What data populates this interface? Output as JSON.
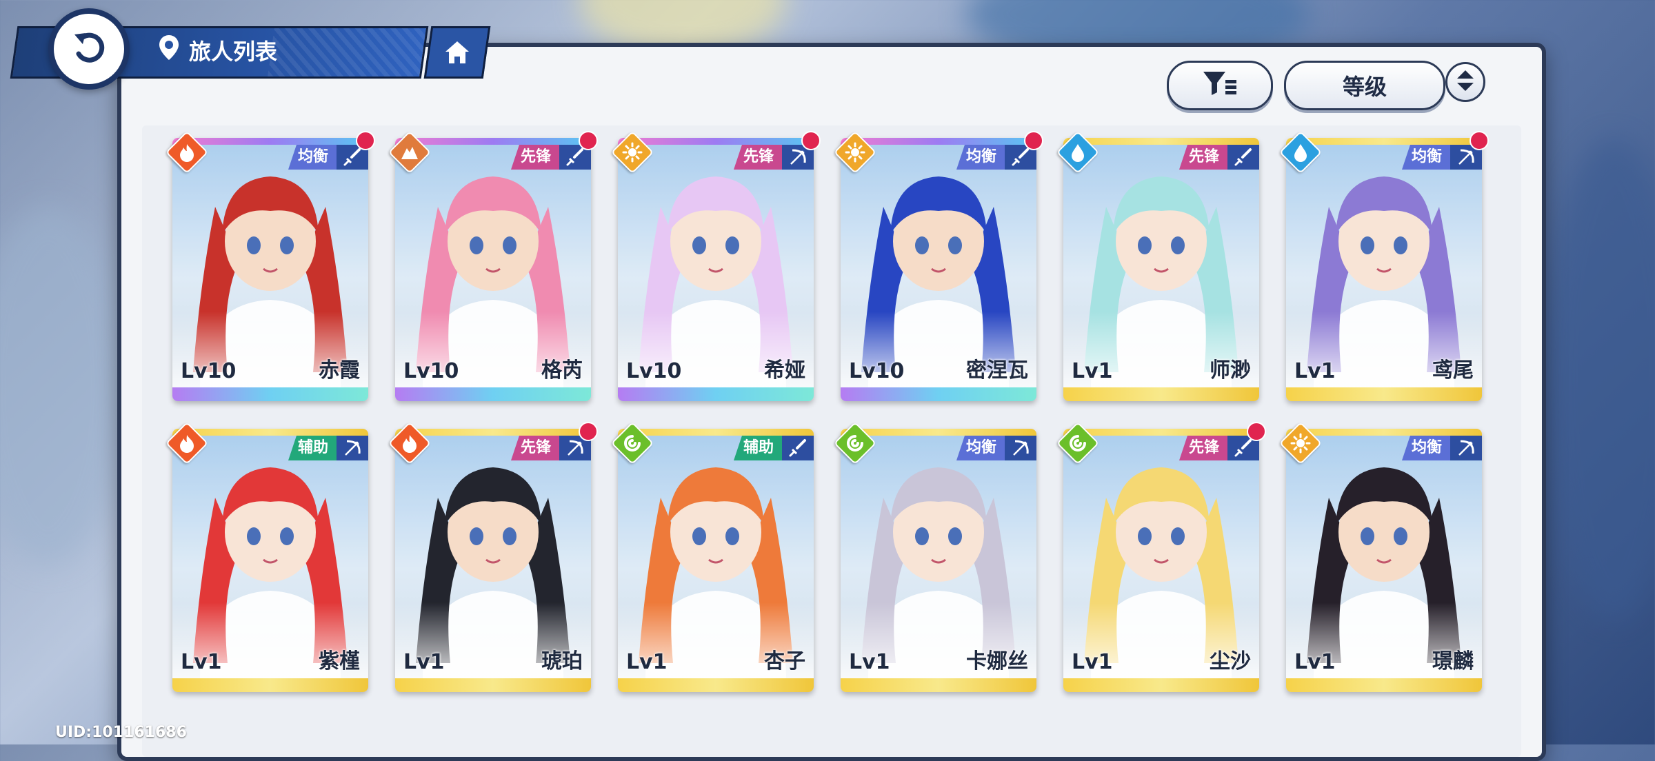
{
  "header": {
    "title": "旅人列表"
  },
  "controls": {
    "sort_label": "等级"
  },
  "uid": "UID:101161686",
  "colors": {
    "role_balanced": "#5b6fd6",
    "role_vanguard": "#c9488f",
    "role_support": "#22a87a",
    "element_fire": "#ef5a28",
    "element_earth": "#e07b3c",
    "element_light": "#f0a72a",
    "element_water": "#2ba0e0",
    "element_wind": "#6bbf2a"
  },
  "cards": [
    {
      "name": "赤霞",
      "level": "Lv10",
      "role": "均衡",
      "element": "fire",
      "weapon": "sword",
      "rarity": "rainbow",
      "new": true,
      "hair": "#c8322b",
      "skin": "#f6dcc8"
    },
    {
      "name": "格芮",
      "level": "Lv10",
      "role": "先锋",
      "element": "earth",
      "weapon": "sword",
      "rarity": "rainbow",
      "new": true,
      "hair": "#f08bb0",
      "skin": "#f6dcc8"
    },
    {
      "name": "希娅",
      "level": "Lv10",
      "role": "先锋",
      "element": "light",
      "weapon": "bow",
      "rarity": "rainbow",
      "new": true,
      "hair": "#e7c7f4",
      "skin": "#f8e4d6"
    },
    {
      "name": "密涅瓦",
      "level": "Lv10",
      "role": "均衡",
      "element": "light",
      "weapon": "sword",
      "rarity": "rainbow",
      "new": true,
      "hair": "#2846c2",
      "skin": "#f6dcc8"
    },
    {
      "name": "师渺",
      "level": "Lv1",
      "role": "先锋",
      "element": "water",
      "weapon": "sword",
      "rarity": "gold",
      "new": false,
      "hair": "#a6e2e2",
      "skin": "#f8e4d6"
    },
    {
      "name": "鸢尾",
      "level": "Lv1",
      "role": "均衡",
      "element": "water",
      "weapon": "bow",
      "rarity": "gold",
      "new": true,
      "hair": "#8c7ad4",
      "skin": "#f8e4d6"
    },
    {
      "name": "紫槿",
      "level": "Lv1",
      "role": "辅助",
      "element": "fire",
      "weapon": "bow",
      "rarity": "gold",
      "new": false,
      "hair": "#e23838",
      "skin": "#f8e4d6"
    },
    {
      "name": "琥珀",
      "level": "Lv1",
      "role": "先锋",
      "element": "fire",
      "weapon": "bow",
      "rarity": "gold",
      "new": true,
      "hair": "#23252e",
      "skin": "#f6dcc8"
    },
    {
      "name": "杏子",
      "level": "Lv1",
      "role": "辅助",
      "element": "wind",
      "weapon": "sword",
      "rarity": "gold",
      "new": false,
      "hair": "#ee7a3a",
      "skin": "#f8e4d6"
    },
    {
      "name": "卡娜丝",
      "level": "Lv1",
      "role": "均衡",
      "element": "wind",
      "weapon": "bow",
      "rarity": "gold",
      "new": false,
      "hair": "#c9c5d8",
      "skin": "#f8e4d6"
    },
    {
      "name": "尘沙",
      "level": "Lv1",
      "role": "先锋",
      "element": "wind",
      "weapon": "sword",
      "rarity": "gold",
      "new": true,
      "hair": "#f5d873",
      "skin": "#f8e4d6"
    },
    {
      "name": "璟麟",
      "level": "Lv1",
      "role": "均衡",
      "element": "light",
      "weapon": "bow",
      "rarity": "gold",
      "new": false,
      "hair": "#26202a",
      "skin": "#f6dcc8"
    }
  ]
}
